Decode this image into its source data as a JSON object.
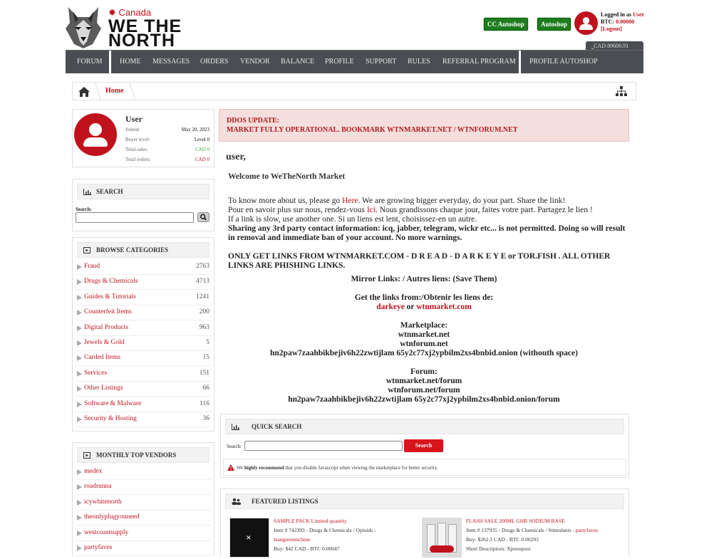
{
  "brand": {
    "country": "Canada",
    "line1": "WE THE",
    "line2": "NORTH"
  },
  "header": {
    "cc_autoshop": "CC Autoshop",
    "autoshop": "Autoshop",
    "logged_in_as": "Logged in as",
    "username": "User",
    "btc_label": "BTC:",
    "btc_value": "0.00000",
    "logout": "[Logout]",
    "cad_balance": "CAD 89606.91"
  },
  "nav": [
    "FORUM",
    "HOME",
    "MESSAGES",
    "ORDERS",
    "VENDOR",
    "BALANCE",
    "PROFILE",
    "SUPPORT",
    "RULES",
    "REFERRAL PROGRAM",
    "PROFILE AUTOSHOP"
  ],
  "breadcrumb": {
    "home": "Home"
  },
  "profile": {
    "name": "User",
    "joined_label": "Joined:",
    "joined": "May 20, 2023",
    "buyer_label": "Buyer level:",
    "buyer": "Level 0",
    "sales_label": "Total sales:",
    "sales": "CAD 0",
    "orders_label": "Total orders:",
    "orders": "CAD 0"
  },
  "search": {
    "title": "SEARCH",
    "label": "Search:"
  },
  "categories": {
    "title": "BROWSE CATEGORIES",
    "items": [
      {
        "name": "Fraud",
        "count": "2763"
      },
      {
        "name": "Drugs & Chemicals",
        "count": "4713"
      },
      {
        "name": "Guides & Tutorials",
        "count": "1241"
      },
      {
        "name": "Counterfeit Items",
        "count": "200"
      },
      {
        "name": "Digital Products",
        "count": "963"
      },
      {
        "name": "Jewels & Gold",
        "count": "5"
      },
      {
        "name": "Carded Items",
        "count": "15"
      },
      {
        "name": "Services",
        "count": "151"
      },
      {
        "name": "Other Listings",
        "count": "66"
      },
      {
        "name": "Software & Malware",
        "count": "116"
      },
      {
        "name": "Security & Hosting",
        "count": "36"
      }
    ]
  },
  "vendors": {
    "title": "MONTHLY TOP VENDORS",
    "items": [
      "medex",
      "roadrunna",
      "icywhitenorth",
      "theonlyplugyouneed",
      "westcoastsupply",
      "partyfaves"
    ]
  },
  "alert": {
    "line1": "DDOS UPDATE:",
    "line2": "MARKET FULLY OPERATIONAL. BOOKMARK WTNMARKET.NET / WTNFORUM.NET"
  },
  "greeting": "user,",
  "welcome": "Welcome to WeTheNorth Market",
  "body": {
    "p1a": "To know more about us, please go ",
    "p1_link": "Here",
    "p1b": ". We are growing bigger everyday, do your part. Share the link!",
    "p2a": "Pour en savoir plus sur nous, rendez-vous ",
    "p2_link": "Ici",
    "p2b": ". Nous grandissons chaque jour, faites votre part. Partagez le lien !",
    "p3": "If a link is slow, use another one. Si un liens est lent, choisissez-en un autre.",
    "p4": "Sharing any 3rd party contact information: icq, jabber, telegram, wickr etc... is not permitted. Doing so will result in removal and immediate ban of your account. No more warnings.",
    "p5": "ONLY GET LINKS FROM WTNMARKET.COM - D R E A D - D A R K E Y E or TOR.FISH . ALL OTHER LINKS ARE PHISHING LINKS."
  },
  "links": {
    "mirror": "Mirror Links: / Autres liens: (Save Them)",
    "get_from": "Get the links from:/Obtenir les liens de:",
    "darkeye": "darkeye",
    "or": " or ",
    "wtnmarket_com": "wtnmarket.com",
    "market_title": "Marketplace:",
    "m1": "wtnmarket.net",
    "m2": "wtnforum.net",
    "m3": "hn2paw7zaahbikbejiv6h22zwtijlam 65y2c77xj2ypbilm2xs4bnbid.onion (withouth space)",
    "forum_title": "Forum:",
    "f1": "wtnmarket.net/forum",
    "f2": "wtnforum.net/forum",
    "f3": "hn2paw7zaahbikbejiv6h22zwtijlam 65y2c77xj2ypbilm2xs4bnbid.onion/forum"
  },
  "quick_search": {
    "title": "QUICK SEARCH",
    "label": "Search:",
    "button": "Search",
    "note_a": "We ",
    "note_b": "highly recommend",
    "note_c": " that you disable Javascript when viewing the marketplace for better security."
  },
  "featured": {
    "title": "FEATURED LISTINGS",
    "items": [
      {
        "title": "SAMPLE PACK Limited quantity",
        "meta": "Item # 742393 - Drugs & Chemicals / Opioids -",
        "vendor": "leangreenmchine",
        "price": "Buy: $42 CAD - BTC 0.00047"
      },
      {
        "title": "FLASH SALE 200ML GHB SODIUM BASE",
        "meta": "Item # 137935 - Drugs & Chemicals / Stimulants - ",
        "vendor": "partyfaves",
        "price": "Buy: $262.5 CAD - BTC 0.00293",
        "desc": "Short Description: Xpresspost"
      }
    ]
  }
}
